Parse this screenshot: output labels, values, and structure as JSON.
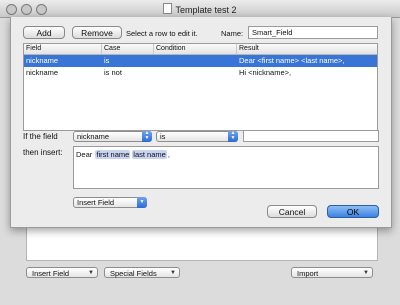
{
  "window": {
    "title": "Template test 2"
  },
  "background_toolbar": {
    "insert_field": "Insert Field",
    "special_fields": "Special Fields",
    "import": "Import"
  },
  "sheet": {
    "add_label": "Add",
    "remove_label": "Remove",
    "hint": "Select a row to edit it.",
    "name_label": "Name:",
    "name_value": "Smart_Field",
    "columns": [
      "Field",
      "Case",
      "Condition",
      "Result"
    ],
    "rows": [
      {
        "field": "nickname",
        "case": "is",
        "condition": "",
        "result": "Dear <first name> <last name>,",
        "selected": true
      },
      {
        "field": "nickname",
        "case": "is not",
        "condition": "",
        "result": "Hi <nickname>,",
        "selected": false
      }
    ],
    "if_label": "If the field",
    "if_field_value": "nickname",
    "if_case_value": "is",
    "if_value": "",
    "then_label": "then insert:",
    "insert_text_prefix": "Dear",
    "token_first": "first name",
    "token_last": "last name",
    "insert_text_suffix": ",",
    "insert_field_label": "Insert Field",
    "cancel_label": "Cancel",
    "ok_label": "OK"
  },
  "colors": {
    "selection": "#3875d7",
    "token": "#c9d3f2",
    "default_button": "#3b82e0"
  }
}
